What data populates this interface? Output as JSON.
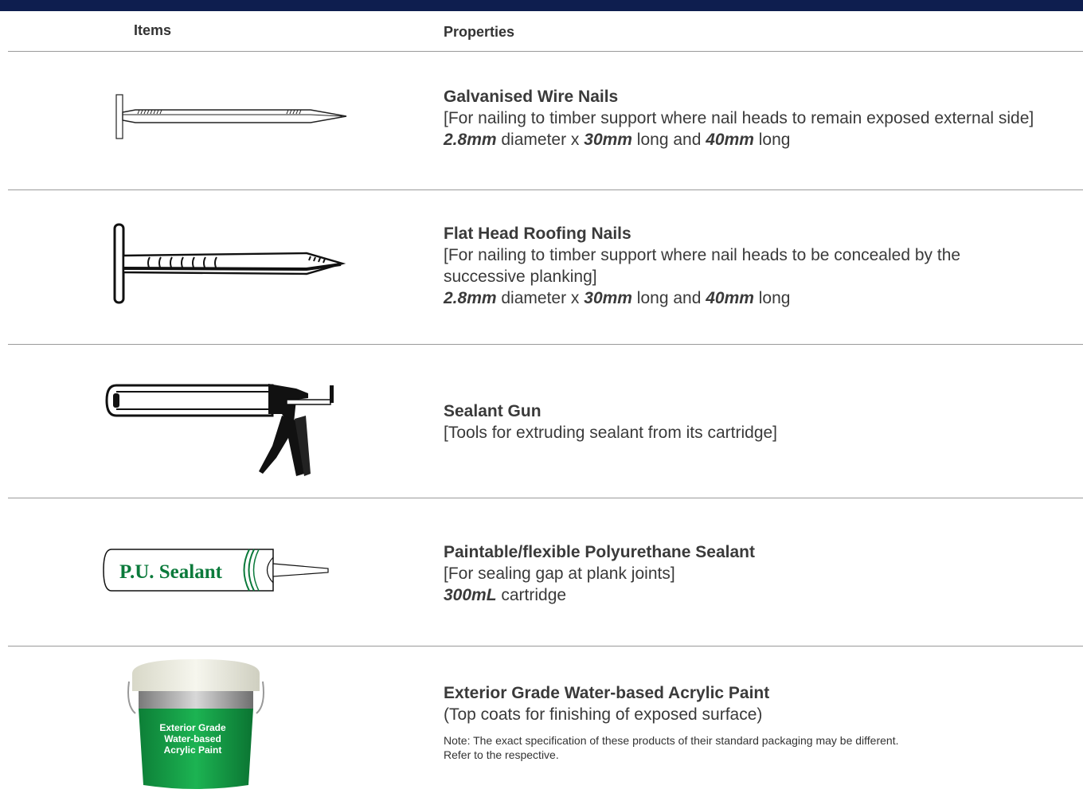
{
  "header": {
    "items_label": "Items",
    "properties_label": "Properties"
  },
  "rows": [
    {
      "name": "Galvanised Wire Nails",
      "description": "[For nailing to timber support where nail heads to remain exposed external side]",
      "spec": {
        "a": "2.8mm",
        "b": " diameter x ",
        "c": "30mm",
        "d": " long and ",
        "e": "40mm",
        "f": " long"
      },
      "icon": "wire-nail-icon"
    },
    {
      "name": "Flat Head Roofing Nails",
      "description": "[For nailing to timber support where nail heads to be concealed by the successive planking]",
      "spec": {
        "a": "2.8mm",
        "b": " diameter x ",
        "c": "30mm",
        "d": " long and ",
        "e": "40mm",
        "f": " long"
      },
      "icon": "roofing-nail-icon"
    },
    {
      "name": "Sealant Gun",
      "description": "[Tools for extruding sealant from its cartridge]",
      "icon": "sealant-gun-icon"
    },
    {
      "name": "Paintable/flexible Polyurethane Sealant",
      "description": "[For sealing gap at plank joints]",
      "spec": {
        "a": "300mL",
        "b": " cartridge"
      },
      "icon": "sealant-cartridge-icon",
      "cartridge_label": "P.U. Sealant"
    },
    {
      "name": "Exterior Grade Water-based Acrylic Paint",
      "description": "(Top coats for finishing of exposed surface)",
      "note_line1": "Note: The exact specification of these products of their standard packaging may be different.",
      "note_line2": "Refer to the respective.",
      "icon": "paint-bucket-icon",
      "bucket_label": [
        "Exterior Grade",
        "Water-based",
        "Acrylic Paint"
      ]
    }
  ],
  "colors": {
    "topbar": "#0e1e4f",
    "sealant_green": "#0b7a3b",
    "bucket_green": "#15a04a"
  }
}
